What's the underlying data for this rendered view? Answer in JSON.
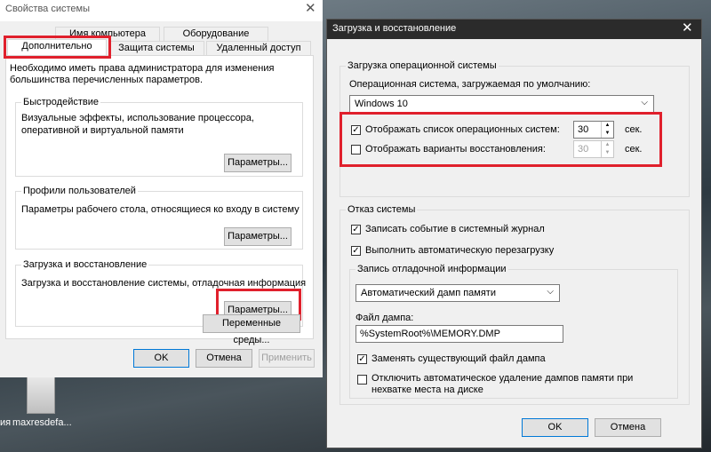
{
  "desktop": {
    "icon_label_left": "ия",
    "icon_label": "maxresdefa..."
  },
  "sysprops": {
    "title": "Свойства системы",
    "tabs_row1": [
      "Имя компьютера",
      "Оборудование"
    ],
    "tabs_row2": [
      "Дополнительно",
      "Защита системы",
      "Удаленный доступ"
    ],
    "admin_note": "Необходимо иметь права администратора для изменения большинства перечисленных параметров.",
    "perf": {
      "title": "Быстродействие",
      "desc": "Визуальные эффекты, использование процессора, оперативной и виртуальной памяти",
      "button": "Параметры..."
    },
    "profiles": {
      "title": "Профили пользователей",
      "desc": "Параметры рабочего стола, относящиеся ко входу в систему",
      "button": "Параметры..."
    },
    "startup": {
      "title": "Загрузка и восстановление",
      "desc": "Загрузка и восстановление системы, отладочная информация",
      "button": "Параметры..."
    },
    "env_button": "Переменные среды...",
    "ok": "OK",
    "cancel": "Отмена",
    "apply": "Применить"
  },
  "recovery": {
    "title": "Загрузка и восстановление",
    "os_group": {
      "title": "Загрузка операционной системы",
      "default_label": "Операционная система, загружаемая по умолчанию:",
      "default_value": "Windows 10",
      "show_list_label": "Отображать список операционных систем:",
      "show_list_checked": true,
      "show_list_value": "30",
      "show_recovery_label": "Отображать варианты восстановления:",
      "show_recovery_checked": false,
      "show_recovery_value": "30",
      "sec": "сек."
    },
    "failure_group": {
      "title": "Отказ системы",
      "write_event_label": "Записать событие в системный журнал",
      "write_event_checked": true,
      "auto_restart_label": "Выполнить автоматическую перезагрузку",
      "auto_restart_checked": true,
      "debug_group": {
        "title": "Запись отладочной информации",
        "dump_type": "Автоматический дамп памяти",
        "dump_file_label": "Файл дампа:",
        "dump_file_value": "%SystemRoot%\\MEMORY.DMP",
        "overwrite_label": "Заменять существующий файл дампа",
        "overwrite_checked": true,
        "disable_auto_delete_label": "Отключить автоматическое удаление дампов памяти при нехватке места на диске",
        "disable_auto_delete_checked": false
      }
    },
    "ok": "OK",
    "cancel": "Отмена"
  },
  "colors": {
    "highlight": "#e0202c",
    "accent": "#0078d7",
    "dark_titlebar": "#2b2b2b"
  }
}
